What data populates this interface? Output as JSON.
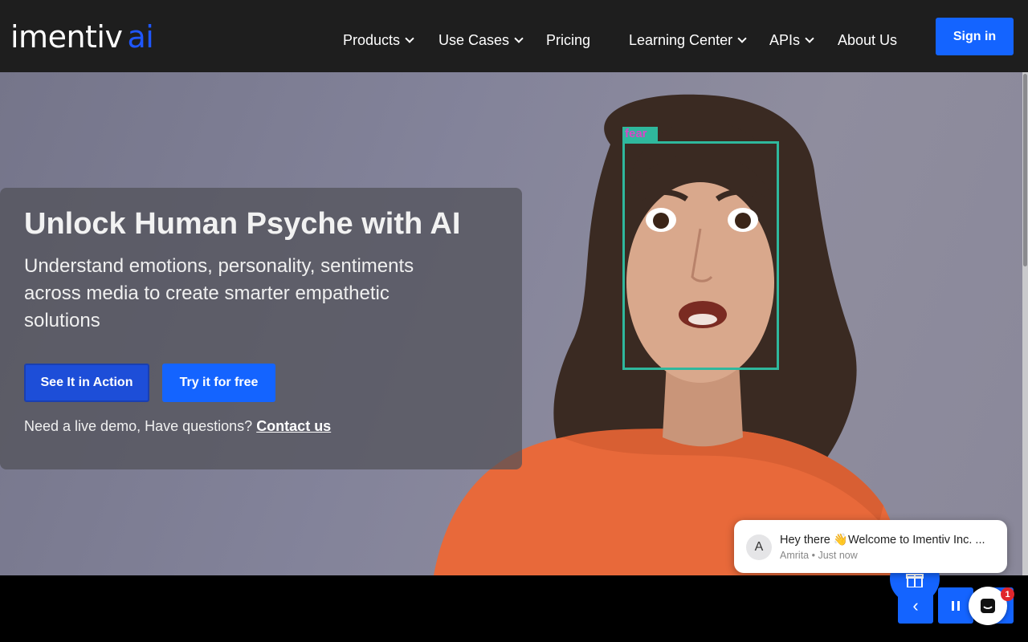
{
  "header": {
    "logo_text": "imentiv",
    "logo_accent": "ai",
    "nav": [
      {
        "label": "Products",
        "has_dropdown": true
      },
      {
        "label": "Use Cases",
        "has_dropdown": true
      },
      {
        "label": "Pricing",
        "has_dropdown": false
      },
      {
        "label": "Learning Center",
        "has_dropdown": true
      },
      {
        "label": "APIs",
        "has_dropdown": true
      },
      {
        "label": "About Us",
        "has_dropdown": false
      }
    ],
    "signin_label": "Sign in"
  },
  "hero": {
    "face_tag": "fear",
    "title": "Unlock Human Psyche with AI",
    "subtitle": "Understand emotions, personality, sentiments across media to create smarter empathetic solutions",
    "primary_button": "See It in Action",
    "secondary_button": "Try it for free",
    "demo_text": "Need a live demo, Have questions?",
    "contact_link": "Contact us"
  },
  "chat": {
    "avatar_letter": "A",
    "message": "Hey there 👋Welcome to Imentiv Inc. ...",
    "sender": "Amrita",
    "time": "Just now",
    "unread_count": "1"
  },
  "colors": {
    "brand_blue": "#1464ff",
    "header_bg": "#1e1e1e",
    "face_box": "#2fb89d",
    "face_tag_text": "#d946c8",
    "badge": "#e0262c"
  }
}
